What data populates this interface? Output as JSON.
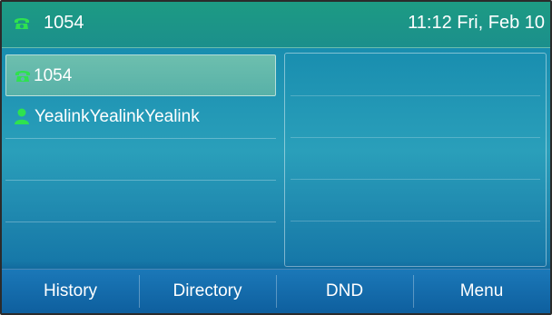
{
  "status": {
    "extension": "1054",
    "datetime": "11:12 Fri, Feb 10",
    "icon": "phone-handset-icon"
  },
  "lines": [
    {
      "label": "1054",
      "icon": "phone-handset-icon",
      "selected": true
    },
    {
      "label": "YealinkYealinkYealink",
      "icon": "contact-person-icon",
      "selected": false
    },
    {
      "label": "",
      "icon": "",
      "selected": false
    },
    {
      "label": "",
      "icon": "",
      "selected": false
    },
    {
      "label": "",
      "icon": "",
      "selected": false
    }
  ],
  "softkeys": [
    {
      "label": "History"
    },
    {
      "label": "Directory"
    },
    {
      "label": "DND"
    },
    {
      "label": "Menu"
    }
  ],
  "colors": {
    "status_bar": "#1d9b83",
    "icon_green": "#2ee24f",
    "softkey_bar": "#1b78b8"
  }
}
